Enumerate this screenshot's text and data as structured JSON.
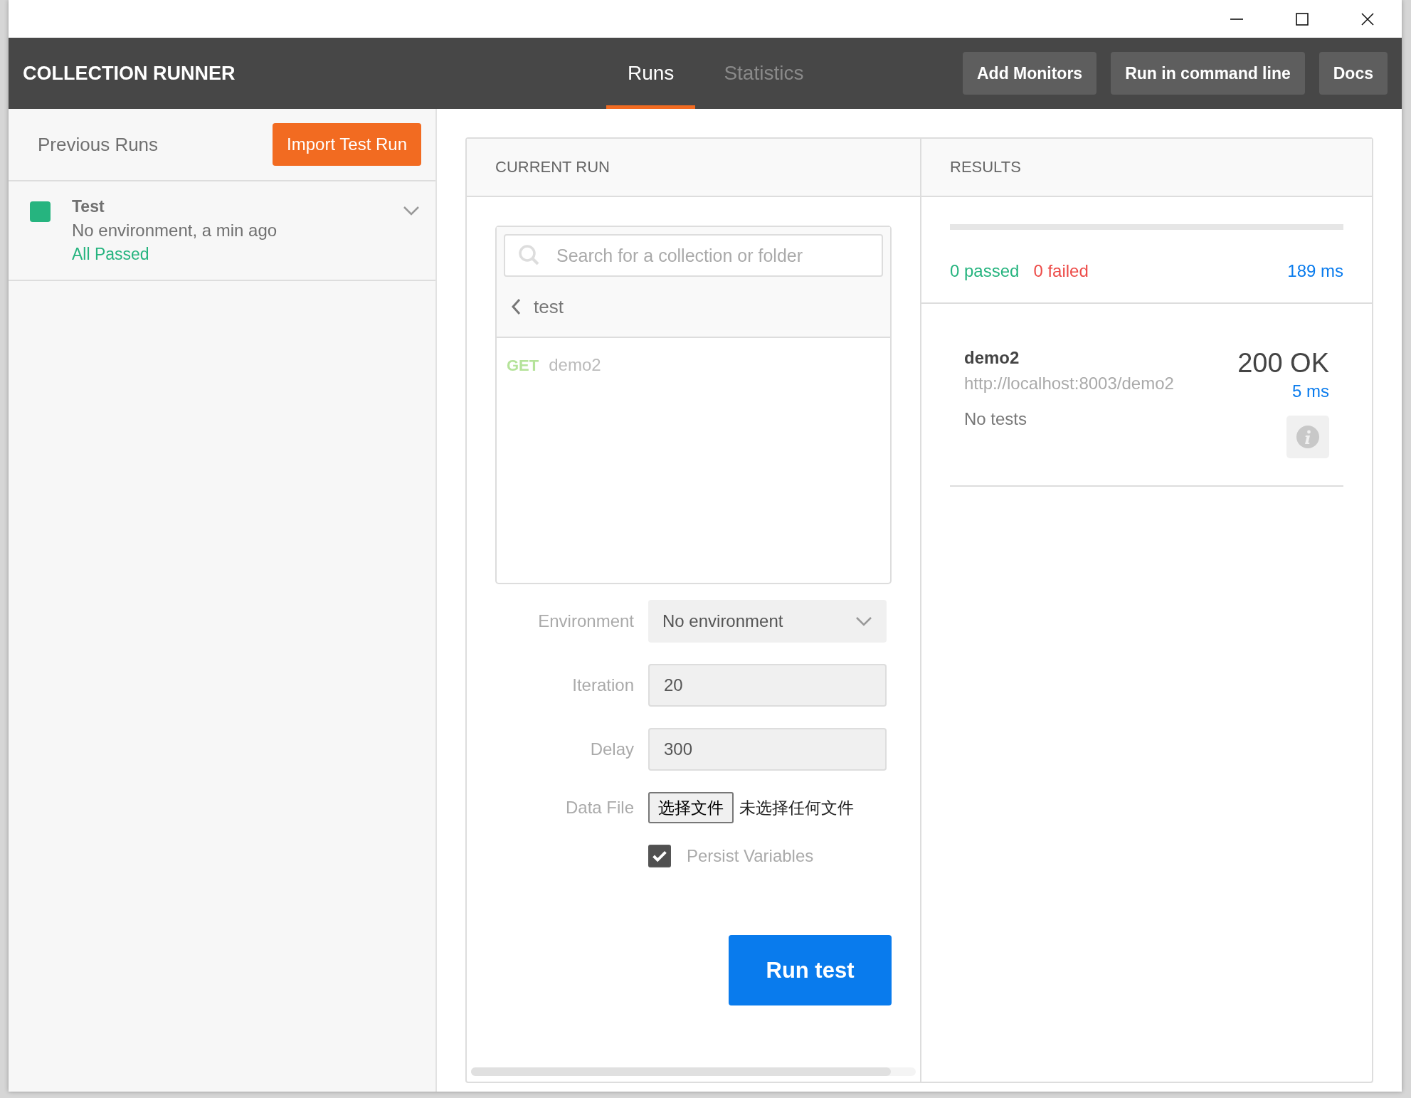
{
  "window": {
    "title": "COLLECTION RUNNER"
  },
  "tabs": [
    {
      "label": "Runs",
      "selected": true
    },
    {
      "label": "Statistics",
      "selected": false
    }
  ],
  "header_buttons": [
    "Add Monitors",
    "Run in command line",
    "Docs"
  ],
  "sidebar": {
    "title": "Previous Runs",
    "import_button": "Import Test Run",
    "runs": [
      {
        "name": "Test",
        "detail": "No environment, a min ago",
        "status": "All Passed",
        "color": "#26b47f",
        "passed": true
      }
    ]
  },
  "current_run": {
    "heading": "CURRENT RUN",
    "search": {
      "placeholder": "Search for a collection or folder"
    },
    "folder": "test",
    "requests": [
      {
        "method": "GET",
        "name": "demo2"
      }
    ],
    "environment": {
      "label": "Environment",
      "value": "No environment"
    },
    "iteration": {
      "label": "Iteration",
      "value": "20"
    },
    "delay": {
      "label": "Delay",
      "value": "300"
    },
    "data_file": {
      "label": "Data File",
      "button": "选择文件",
      "status": "未选择任何文件"
    },
    "persist_variables": {
      "label": "Persist Variables",
      "checked": true
    },
    "run_button": "Run test"
  },
  "results": {
    "heading": "RESULTS",
    "passed": "0 passed",
    "failed": "0 failed",
    "time": "189 ms",
    "items": [
      {
        "name": "demo2",
        "url": "http://localhost:8003/demo2",
        "tests": "No tests",
        "status": "200 OK",
        "time": "5 ms"
      }
    ]
  }
}
